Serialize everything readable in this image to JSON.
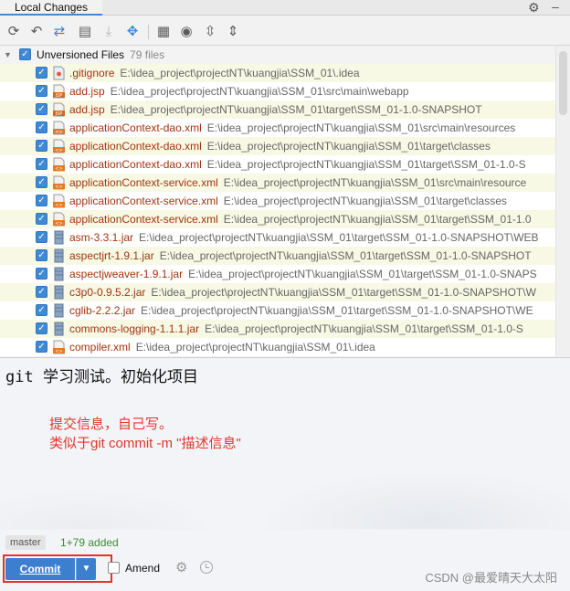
{
  "window": {
    "tab_title": "Local Changes"
  },
  "toolbar": {
    "buttons": [
      {
        "name": "refresh-icon",
        "glyph": "⟳"
      },
      {
        "name": "rollback-icon",
        "glyph": "↶"
      },
      {
        "name": "diff-icon",
        "glyph": "⇄"
      },
      {
        "name": "edit-source-icon",
        "glyph": "▤"
      },
      {
        "name": "download-icon",
        "glyph": "⤓"
      },
      {
        "name": "move-changelist-icon",
        "glyph": "✥"
      },
      {
        "name": "group-by-icon",
        "glyph": "▦"
      },
      {
        "name": "show-options-icon",
        "glyph": "◉"
      },
      {
        "name": "expand-all-icon",
        "glyph": "⇳"
      },
      {
        "name": "collapse-all-icon",
        "glyph": "⇕"
      }
    ]
  },
  "tree": {
    "group": {
      "label": "Unversioned Files",
      "count": "79 files"
    },
    "files": [
      {
        "name": ".gitignore",
        "path": "E:\\idea_project\\projectNT\\kuangjia\\SSM_01\\.idea",
        "icon": "gitignore",
        "color": "#a2340f"
      },
      {
        "name": "add.jsp",
        "path": "E:\\idea_project\\projectNT\\kuangjia\\SSM_01\\src\\main\\webapp",
        "icon": "jsp",
        "color": "#a2340f"
      },
      {
        "name": "add.jsp",
        "path": "E:\\idea_project\\projectNT\\kuangjia\\SSM_01\\target\\SSM_01-1.0-SNAPSHOT",
        "icon": "jsp",
        "color": "#a2340f"
      },
      {
        "name": "applicationContext-dao.xml",
        "path": "E:\\idea_project\\projectNT\\kuangjia\\SSM_01\\src\\main\\resources",
        "icon": "xml",
        "color": "#a2340f"
      },
      {
        "name": "applicationContext-dao.xml",
        "path": "E:\\idea_project\\projectNT\\kuangjia\\SSM_01\\target\\classes",
        "icon": "xml",
        "color": "#a2340f"
      },
      {
        "name": "applicationContext-dao.xml",
        "path": "E:\\idea_project\\projectNT\\kuangjia\\SSM_01\\target\\SSM_01-1.0-S",
        "icon": "xml",
        "color": "#a2340f"
      },
      {
        "name": "applicationContext-service.xml",
        "path": "E:\\idea_project\\projectNT\\kuangjia\\SSM_01\\src\\main\\resource",
        "icon": "xml",
        "color": "#a2340f"
      },
      {
        "name": "applicationContext-service.xml",
        "path": "E:\\idea_project\\projectNT\\kuangjia\\SSM_01\\target\\classes",
        "icon": "xml",
        "color": "#a2340f"
      },
      {
        "name": "applicationContext-service.xml",
        "path": "E:\\idea_project\\projectNT\\kuangjia\\SSM_01\\target\\SSM_01-1.0",
        "icon": "xml",
        "color": "#a2340f"
      },
      {
        "name": "asm-3.3.1.jar",
        "path": "E:\\idea_project\\projectNT\\kuangjia\\SSM_01\\target\\SSM_01-1.0-SNAPSHOT\\WEB",
        "icon": "jar",
        "color": "#a2340f"
      },
      {
        "name": "aspectjrt-1.9.1.jar",
        "path": "E:\\idea_project\\projectNT\\kuangjia\\SSM_01\\target\\SSM_01-1.0-SNAPSHOT",
        "icon": "jar",
        "color": "#a2340f"
      },
      {
        "name": "aspectjweaver-1.9.1.jar",
        "path": "E:\\idea_project\\projectNT\\kuangjia\\SSM_01\\target\\SSM_01-1.0-SNAPS",
        "icon": "jar",
        "color": "#a2340f"
      },
      {
        "name": "c3p0-0.9.5.2.jar",
        "path": "E:\\idea_project\\projectNT\\kuangjia\\SSM_01\\target\\SSM_01-1.0-SNAPSHOT\\W",
        "icon": "jar",
        "color": "#a2340f"
      },
      {
        "name": "cglib-2.2.2.jar",
        "path": "E:\\idea_project\\projectNT\\kuangjia\\SSM_01\\target\\SSM_01-1.0-SNAPSHOT\\WE",
        "icon": "jar",
        "color": "#a2340f"
      },
      {
        "name": "commons-logging-1.1.1.jar",
        "path": "E:\\idea_project\\projectNT\\kuangjia\\SSM_01\\target\\SSM_01-1.0-S",
        "icon": "jar",
        "color": "#a2340f"
      },
      {
        "name": "compiler.xml",
        "path": "E:\\idea_project\\projectNT\\kuangjia\\SSM_01\\.idea",
        "icon": "xml",
        "color": "#a2340f"
      }
    ]
  },
  "commit_message": {
    "text": "git 学习测试。初始化项目",
    "annotation_line1": "提交信息，自己写。",
    "annotation_line2": "类似于git commit -m \"描述信息\""
  },
  "status": {
    "branch": "master",
    "changes": "1+79 added"
  },
  "bottom": {
    "commit_label": "Commit",
    "amend_label": "Amend",
    "watermark": "CSDN @最爱晴天大太阳"
  },
  "colors": {
    "accent": "#3d7fcf",
    "unversioned_text": "#a2340f",
    "added_text": "#3c8c35",
    "annotation": "#e0372c",
    "highlight_box": "#e8312a"
  }
}
